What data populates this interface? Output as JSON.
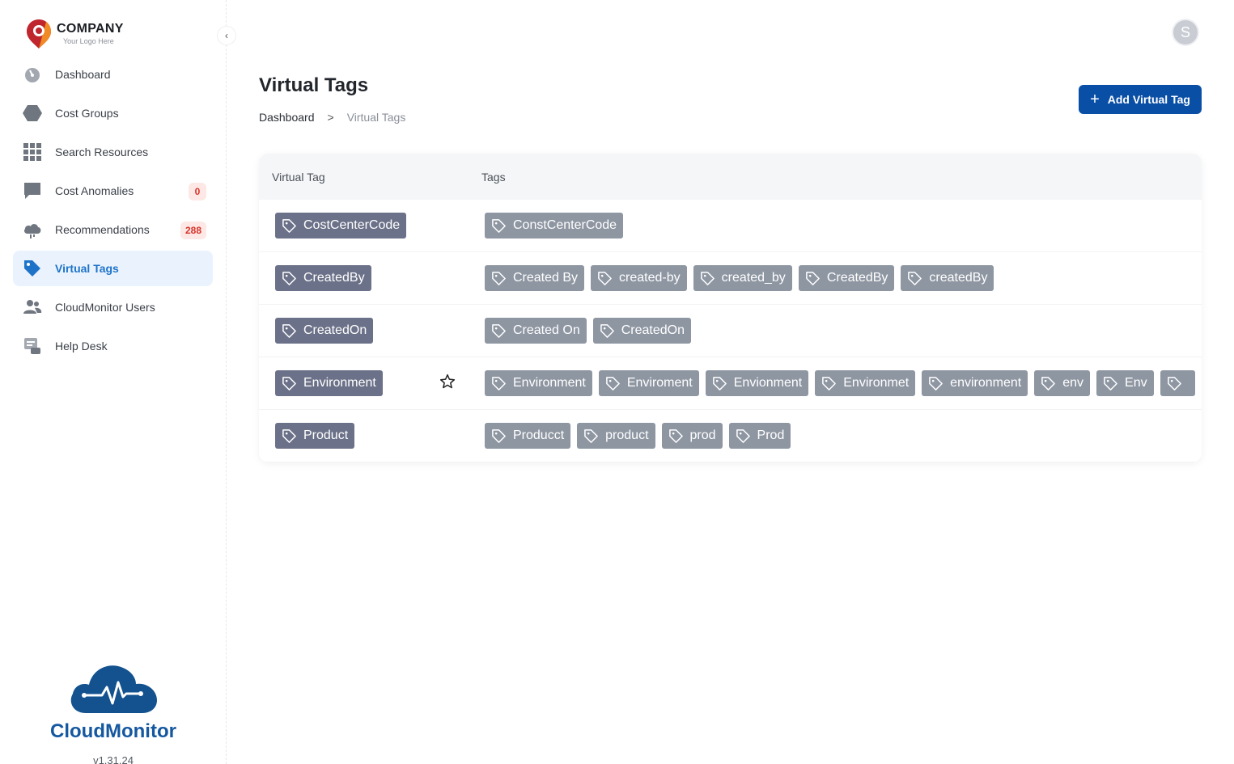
{
  "brand": {
    "name": "COMPANY",
    "tagline": "Your Logo Here"
  },
  "sidebar": {
    "items": [
      {
        "label": "Dashboard",
        "icon": "gauge-icon"
      },
      {
        "label": "Cost Groups",
        "icon": "hexagon-icon"
      },
      {
        "label": "Search Resources",
        "icon": "grid-icon"
      },
      {
        "label": "Cost Anomalies",
        "icon": "chat-icon",
        "badge": "0"
      },
      {
        "label": "Recommendations",
        "icon": "cloud-icon",
        "badge": "288"
      },
      {
        "label": "Virtual Tags",
        "icon": "tag-icon",
        "active": true
      },
      {
        "label": "CloudMonitor Users",
        "icon": "users-icon"
      },
      {
        "label": "Help Desk",
        "icon": "helpdesk-icon"
      }
    ]
  },
  "footer": {
    "product": "CloudMonitor",
    "version": "v1.31.24"
  },
  "header": {
    "avatar_letter": "S"
  },
  "page": {
    "title": "Virtual Tags",
    "breadcrumb": {
      "home": "Dashboard",
      "separator": ">",
      "current": "Virtual Tags"
    },
    "add_button": "Add Virtual Tag"
  },
  "table": {
    "columns": [
      "Virtual Tag",
      "Tags"
    ],
    "rows": [
      {
        "virtual_tag": "CostCenterCode",
        "tags": [
          "ConstCenterCode"
        ]
      },
      {
        "virtual_tag": "CreatedBy",
        "tags": [
          "Created By",
          "created-by",
          "created_by",
          "CreatedBy",
          "createdBy"
        ]
      },
      {
        "virtual_tag": "CreatedOn",
        "tags": [
          "Created On",
          "CreatedOn"
        ]
      },
      {
        "virtual_tag": "Environment",
        "starred": true,
        "tags": [
          "Environment",
          "Enviroment",
          "Envionment",
          "Environmet",
          "environment",
          "env",
          "Env",
          ""
        ]
      },
      {
        "virtual_tag": "Product",
        "tags": [
          "Producct",
          "product",
          "prod",
          "Prod"
        ]
      }
    ]
  },
  "colors": {
    "accent": "#0a4fa6",
    "active_bg": "#eaf3fd",
    "active_text": "#1e73c9",
    "chip_primary": "#6b7188",
    "chip_secondary": "#8e96a2",
    "badge_text": "#d8342a"
  }
}
